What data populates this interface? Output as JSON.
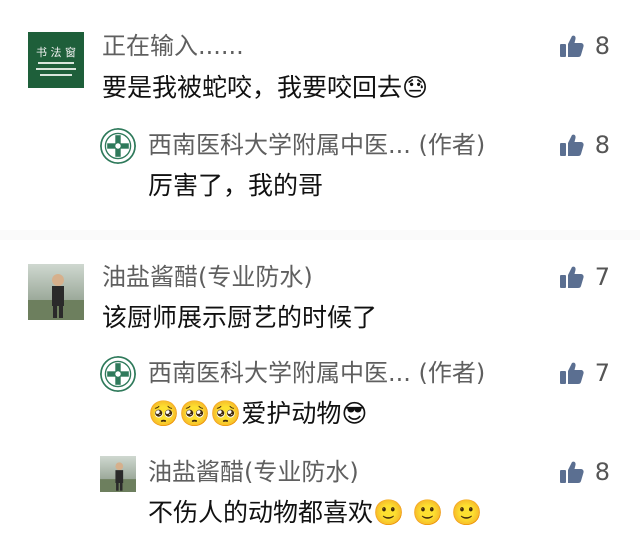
{
  "colors": {
    "name": "#5f5f5f",
    "text": "#111111",
    "thumb": "#5b6f91",
    "avatar_green": "#1e5f3a"
  },
  "comments": [
    {
      "author": "正在输入......",
      "avatar": "green-calligraphy-avatar",
      "text": "要是我被蛇咬，我要咬回去😓",
      "likes": "8",
      "replies": [
        {
          "author": "西南医科大学附属中医...",
          "author_tag": "(作者)",
          "avatar": "hospital-logo-avatar",
          "text": "厉害了，我的哥",
          "likes": "8"
        }
      ]
    },
    {
      "author": "油盐酱醋(专业防水)",
      "avatar": "man-photo-avatar",
      "text": "该厨师展示厨艺的时候了",
      "likes": "7",
      "replies": [
        {
          "author": "西南医科大学附属中医...",
          "author_tag": "(作者)",
          "avatar": "hospital-logo-avatar",
          "text": "🥺🥺🥺爱护动物😎",
          "likes": "7"
        },
        {
          "author": "油盐酱醋(专业防水)",
          "author_tag": "",
          "avatar": "man-photo-avatar",
          "text": "不伤人的动物都喜欢🙂 🙂 🙂",
          "likes": "8"
        }
      ]
    }
  ]
}
